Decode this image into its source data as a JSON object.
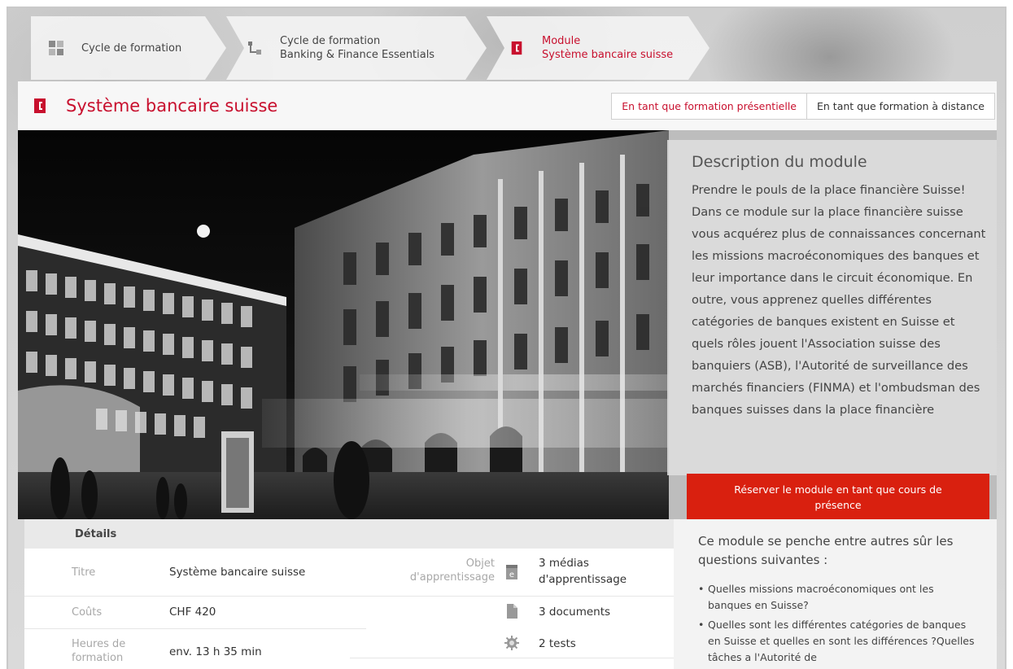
{
  "breadcrumb": [
    {
      "line1": "Cycle de formation",
      "line2": "",
      "icon": "grid-icon"
    },
    {
      "line1": "Cycle de formation",
      "line2": "Banking & Finance Essentials",
      "icon": "hierarchy-icon"
    },
    {
      "line1": "Module",
      "line2": "Système bancaire suisse",
      "icon": "module-icon"
    }
  ],
  "title": "Système bancaire suisse",
  "mode_tabs": {
    "presential": "En tant que formation présentielle",
    "distance": "En tant que formation à distance"
  },
  "description": {
    "heading": "Description du module",
    "text": "Prendre le pouls de la place financière Suisse! Dans ce module sur la place financière suisse vous acquérez plus de connaissances concernant les missions macroéconomiques des banques et leur importance dans le circuit économique. En outre, vous apprenez quelles différentes catégories de banques existent en Suisse et quels rôles jouent l'Association suisse des banquiers (ASB), l'Autorité de surveillance des marchés financiers (FINMA) et l'ombudsman des banques suisses dans la place financière"
  },
  "reserve_button": "Réserver le module en tant que cours de présence",
  "questions": {
    "lead": "Ce module se penche entre autres sûr les questions suivantes :",
    "items": [
      "Quelles missions macroéconomiques ont les banques en Suisse?",
      "Quelles sont les différentes catégories de banques en Suisse et quelles en sont les différences ?Quelles tâches a l'Autorité de"
    ]
  },
  "details": {
    "heading": "Détails",
    "rows": [
      {
        "label": "Titre",
        "value": "Système bancaire suisse"
      },
      {
        "label": "Coûts",
        "value": "CHF 420"
      },
      {
        "label": "Heures de formation",
        "value": "env. 13 h 35 min"
      }
    ],
    "objects_label": "Objet d'apprentissage",
    "objects": [
      {
        "icon": "e-media-icon",
        "value": "3 médias d'apprentissage"
      },
      {
        "icon": "document-icon",
        "value": "3 documents"
      },
      {
        "icon": "test-badge-icon",
        "value": "2 tests"
      }
    ]
  },
  "colors": {
    "accent": "#c8102e",
    "button": "#d9200f"
  }
}
